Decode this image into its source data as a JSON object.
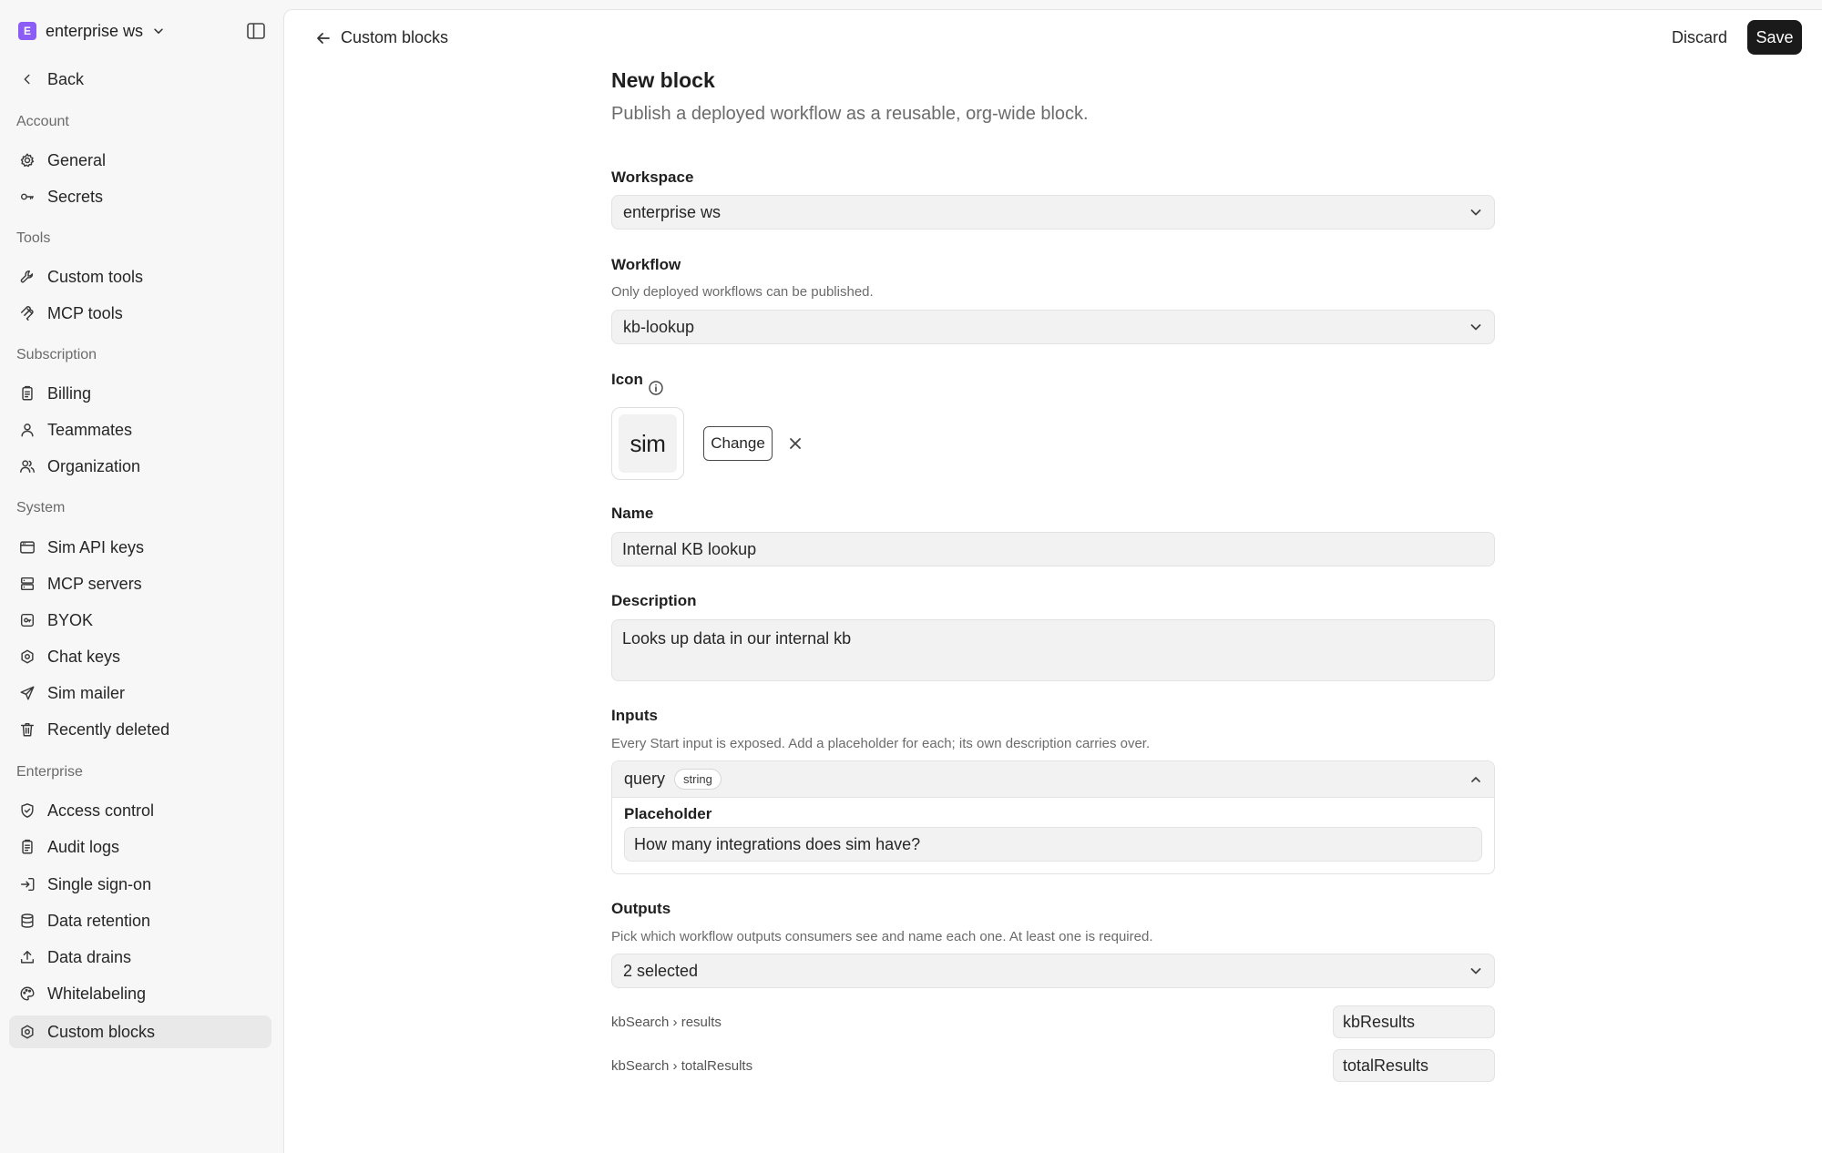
{
  "sidebar": {
    "workspace": {
      "badge": "E",
      "name": "enterprise ws"
    },
    "back_label": "Back",
    "sections": {
      "account": "Account",
      "tools": "Tools",
      "subscription": "Subscription",
      "system": "System",
      "enterprise": "Enterprise"
    },
    "items": {
      "general": "General",
      "secrets": "Secrets",
      "custom_tools": "Custom tools",
      "mcp_tools": "MCP tools",
      "billing": "Billing",
      "teammates": "Teammates",
      "organization": "Organization",
      "sim_api_keys": "Sim API keys",
      "mcp_servers": "MCP servers",
      "byok": "BYOK",
      "chat_keys": "Chat keys",
      "sim_mailer": "Sim mailer",
      "recently_deleted": "Recently deleted",
      "access_control": "Access control",
      "audit_logs": "Audit logs",
      "single_sign_on": "Single sign-on",
      "data_retention": "Data retention",
      "data_drains": "Data drains",
      "whitelabeling": "Whitelabeling",
      "custom_blocks": "Custom blocks"
    },
    "active_item": "custom_blocks",
    "badge_color": "#8b5cf6"
  },
  "header": {
    "breadcrumb": "Custom blocks",
    "discard_label": "Discard",
    "save_label": "Save"
  },
  "form": {
    "title": "New block",
    "subtitle": "Publish a deployed workflow as a reusable, org-wide block.",
    "workspace": {
      "label": "Workspace",
      "value": "enterprise ws"
    },
    "workflow": {
      "label": "Workflow",
      "help": "Only deployed workflows can be published.",
      "value": "kb-lookup"
    },
    "icon": {
      "label": "Icon",
      "preview_text": "sim",
      "change_label": "Change"
    },
    "name": {
      "label": "Name",
      "value": "Internal KB lookup"
    },
    "description": {
      "label": "Description",
      "value": "Looks up data in our internal kb"
    },
    "inputs": {
      "label": "Inputs",
      "help": "Every Start input is exposed. Add a placeholder for each; its own description carries over.",
      "items": [
        {
          "name": "query",
          "type": "string",
          "placeholder_label": "Placeholder",
          "placeholder_value": "How many integrations does sim have?"
        }
      ]
    },
    "outputs": {
      "label": "Outputs",
      "help": "Pick which workflow outputs consumers see and name each one. At least one is required.",
      "selected": "2 selected",
      "rows": [
        {
          "path": "kbSearch › results",
          "alias": "kbResults"
        },
        {
          "path": "kbSearch › totalResults",
          "alias": "totalResults"
        }
      ]
    }
  }
}
